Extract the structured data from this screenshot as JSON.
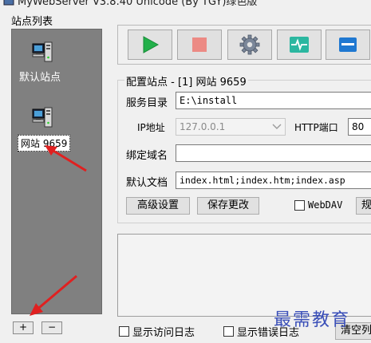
{
  "window": {
    "title": "MyWebServer V3.8.40 Unicode (By TGY)绿色版"
  },
  "site_list": {
    "label": "站点列表",
    "items": [
      {
        "label": "默认站点",
        "icon": "server-computer-icon"
      },
      {
        "label": "网站 9659",
        "icon": "server-computer-icon",
        "selected": true
      }
    ],
    "add_label": "+",
    "remove_label": "−"
  },
  "toolbar": {
    "buttons": [
      {
        "name": "start",
        "icon": "play-icon",
        "color": "#22b04a"
      },
      {
        "name": "stop",
        "icon": "stop-icon",
        "color": "#e5594f"
      },
      {
        "name": "settings",
        "icon": "gear-icon",
        "color": "#6b7a8f"
      },
      {
        "name": "monitor",
        "icon": "pulse-icon",
        "color": "#2bb7a0"
      },
      {
        "name": "window",
        "icon": "window-icon",
        "color": "#1f78d1"
      }
    ]
  },
  "config": {
    "title": "配置站点 - [1] 网站  9659",
    "root_label": "服务目录",
    "root_value": "E:\\install",
    "ip_label": "IP地址",
    "ip_value": "127.0.0.1",
    "http_port_label": "HTTP端口",
    "http_port_value": "80",
    "domain_label": "绑定域名",
    "domain_value": "",
    "default_doc_label": "默认文档",
    "default_doc_value": "index.html;index.htm;index.asp",
    "advanced_label": "高级设置",
    "save_label": "保存更改",
    "webdav_label": "WebDAV",
    "rules_label": "规"
  },
  "log": {
    "show_access_label": "显示访问日志",
    "show_error_label": "显示错误日志",
    "clear_label": "清空列"
  },
  "watermark": "最需教育",
  "colors": {
    "arrow": "#e02020",
    "site_panel": "#808080"
  }
}
